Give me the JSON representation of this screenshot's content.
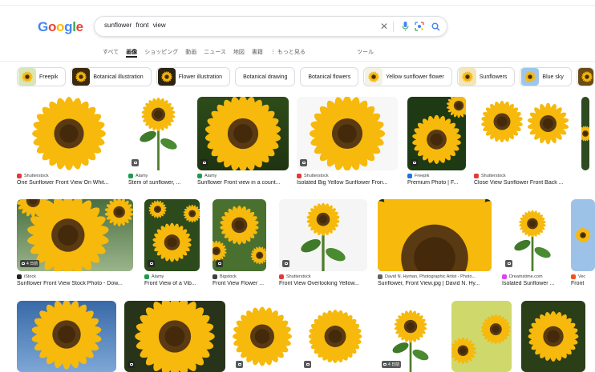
{
  "logo": {
    "letters": [
      "G",
      "o",
      "o",
      "g",
      "l",
      "e"
    ],
    "colors": [
      "#4285f4",
      "#ea4335",
      "#fbbc05",
      "#4285f4",
      "#34a853",
      "#ea4335"
    ]
  },
  "search": {
    "query": "sunflower  front  view"
  },
  "tabs": [
    "すべて",
    "画像",
    "ショッピング",
    "動画",
    "ニュース",
    "地図",
    "書籍",
    "⋮ もっと見る"
  ],
  "tools_label": "ツール",
  "chips": [
    {
      "label": "Freepik",
      "img": true
    },
    {
      "label": "Botanical illustration",
      "img": true
    },
    {
      "label": "Flower illustration",
      "img": true
    },
    {
      "label": "Botanical drawing",
      "img": false
    },
    {
      "label": "Botanical flowers",
      "img": false
    },
    {
      "label": "Yellow sunflower flower",
      "img": true
    },
    {
      "label": "Sunflowers",
      "img": true
    },
    {
      "label": "Blue sky",
      "img": true
    },
    {
      "label": "",
      "img": true
    }
  ],
  "row1": [
    {
      "source": "Shutterstock",
      "title": "One Sunflower Front View On Whit...",
      "favicon": "#e53935"
    },
    {
      "source": "Alamy",
      "title": "Stem of sunflower, ...",
      "favicon": "#1b9e4b"
    },
    {
      "source": "Alamy",
      "title": "Sunflower Front view in a count...",
      "favicon": "#1b9e4b"
    },
    {
      "source": "Shutterstock",
      "title": "Isolated Big Yellow Sunflower Fron...",
      "favicon": "#e53935"
    },
    {
      "source": "Freepik",
      "title": "Premium Photo | F...",
      "favicon": "#1a73e8"
    },
    {
      "source": "Shutterstock",
      "title": "Close View Sunflower Front Back ...",
      "favicon": "#e53935"
    }
  ],
  "row2": [
    {
      "source": "iStock",
      "title": "Sunflower Front View Stock Photo - Dow...",
      "favicon": "#202124",
      "badge": "4 日前"
    },
    {
      "source": "Alamy",
      "title": "Front View of a Vib...",
      "favicon": "#1b9e4b"
    },
    {
      "source": "Bigstock",
      "title": "Front View Flower ...",
      "favicon": "#3c4043"
    },
    {
      "source": "Shutterstock",
      "title": "Front View Overlooking Yellow...",
      "favicon": "#e53935"
    },
    {
      "source": "David N. Hyman, Photographic Artist - Photo...",
      "title": "Sunflower, Front View.jpg | David N. Hy...",
      "favicon": "#5f6368"
    },
    {
      "source": "Dreamstime.com",
      "title": "Isolated Sunflower ...",
      "favicon": "#e040fb"
    },
    {
      "source": "Vec",
      "title": "Front",
      "favicon": "#f4511e"
    }
  ],
  "row3": [
    {
      "badge": ""
    },
    {
      "badge": ""
    },
    {
      "badge": ""
    },
    {
      "badge": ""
    },
    {
      "badge": "4 日前"
    },
    {
      "badge": ""
    },
    {
      "badge": ""
    }
  ]
}
